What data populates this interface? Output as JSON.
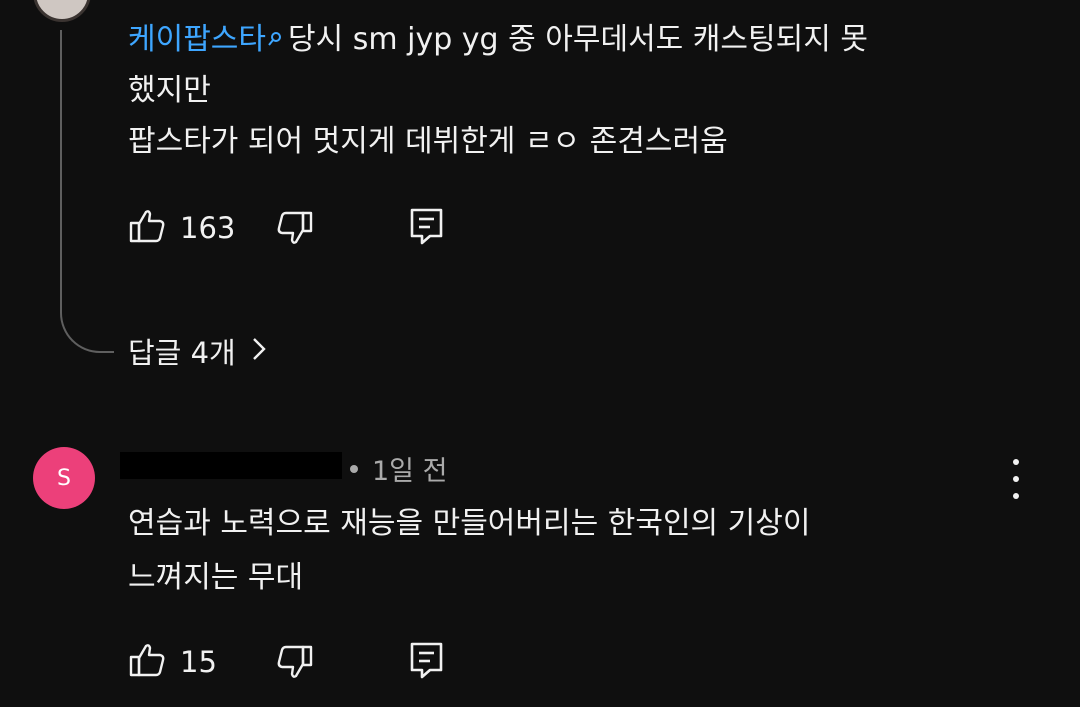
{
  "comment1": {
    "mention": "케이팝스타",
    "line1": "당시 sm jyp yg 중 아무데서도 캐스팅되지 못",
    "line2": "했지만",
    "line3": "팝스타가 되어 멋지게 데뷔한게 ㄹㅇ 존견스러움",
    "likes": "163",
    "icons": {
      "like": "thumb-up-icon",
      "dislike": "thumb-down-icon",
      "reply": "reply-icon",
      "mention": "search-icon"
    }
  },
  "replies": {
    "label": "답글 4개",
    "icon": "chevron-right-icon"
  },
  "comment2": {
    "avatar_letter": "S",
    "avatar_color": "#ec407a",
    "time": "1일 전",
    "line1": "연습과 노력으로 재능을 만들어버리는 한국인의 기상이",
    "line2": "느껴지는 무대",
    "likes": "15",
    "icons": {
      "like": "thumb-up-icon",
      "dislike": "thumb-down-icon",
      "reply": "reply-icon",
      "menu": "more-vert-icon"
    }
  },
  "colors": {
    "background": "#0f0f0f",
    "mention": "#3ea6ff",
    "meta": "#aaaaaa"
  }
}
